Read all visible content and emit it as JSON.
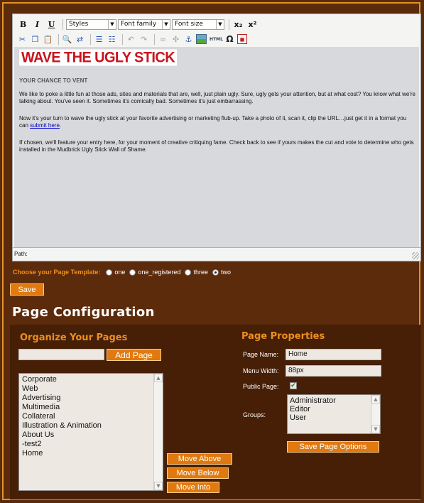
{
  "editor": {
    "toolbar": {
      "bold": "B",
      "italic": "I",
      "underline": "U",
      "styles_select": "Styles",
      "font_family_select": "Font family",
      "font_size_select": "Font size",
      "subscript": "x₂",
      "superscript": "x²",
      "html_button": "HTML",
      "special_char_button": "Ω"
    },
    "content": {
      "logo_text": "WAVE THE UGLY STICK",
      "subheading": "YOUR CHANCE TO VENT",
      "paragraph1": "We like to poke a little fun at those ads, sites and materials that are, well, just plain ugly. Sure, ugly gets your attention, but at what cost? You know what we're talking about. You've seen it. Sometimes it's comically bad. Sometimes it's just embarrassing.",
      "paragraph2_before_link": "Now it's your turn to wave the ugly stick at your favorite advertising or marketing flub-up. Take a photo of it, scan it, clip the URL…just get it in a format you can ",
      "paragraph2_link": "submit here",
      "paragraph2_after_link": ".",
      "paragraph3": "If chosen, we'll feature your entry here, for your moment of creative critiquing fame. Check back to see if yours makes the cut and vote to determine who gets installed in the Mudbrick Ugly Stick Wall of Shame."
    },
    "path_label": "Path:"
  },
  "template_chooser": {
    "label": "Choose your Page Template:",
    "options": [
      "one",
      "one_registered",
      "three",
      "two"
    ],
    "selected": "two"
  },
  "save_button": "Save",
  "page_configuration": {
    "title": "Page Configuration",
    "organize": {
      "title": "Organize Your Pages",
      "new_page_value": "",
      "add_page_button": "Add Page",
      "pages": [
        "Corporate",
        "Web",
        "Advertising",
        "Multimedia",
        "Collateral",
        "Illustration & Animation",
        "About Us",
        "-test2",
        "Home"
      ],
      "move_above": "Move Above",
      "move_below": "Move Below",
      "move_into": "Move Into"
    },
    "properties": {
      "title": "Page Properties",
      "page_name_label": "Page Name:",
      "page_name_value": "Home",
      "menu_width_label": "Menu Width:",
      "menu_width_value": "88px",
      "public_page_label": "Public Page:",
      "public_page_checked": true,
      "groups_label": "Groups:",
      "groups": [
        "Administrator",
        "Editor",
        "User"
      ],
      "save_options_button": "Save Page Options"
    }
  },
  "colors": {
    "background": "#5c2b0c",
    "panel": "#461f06",
    "accent_orange": "#e07a10",
    "heading_orange": "#ee8f1e",
    "logo_red": "#c8141e"
  }
}
